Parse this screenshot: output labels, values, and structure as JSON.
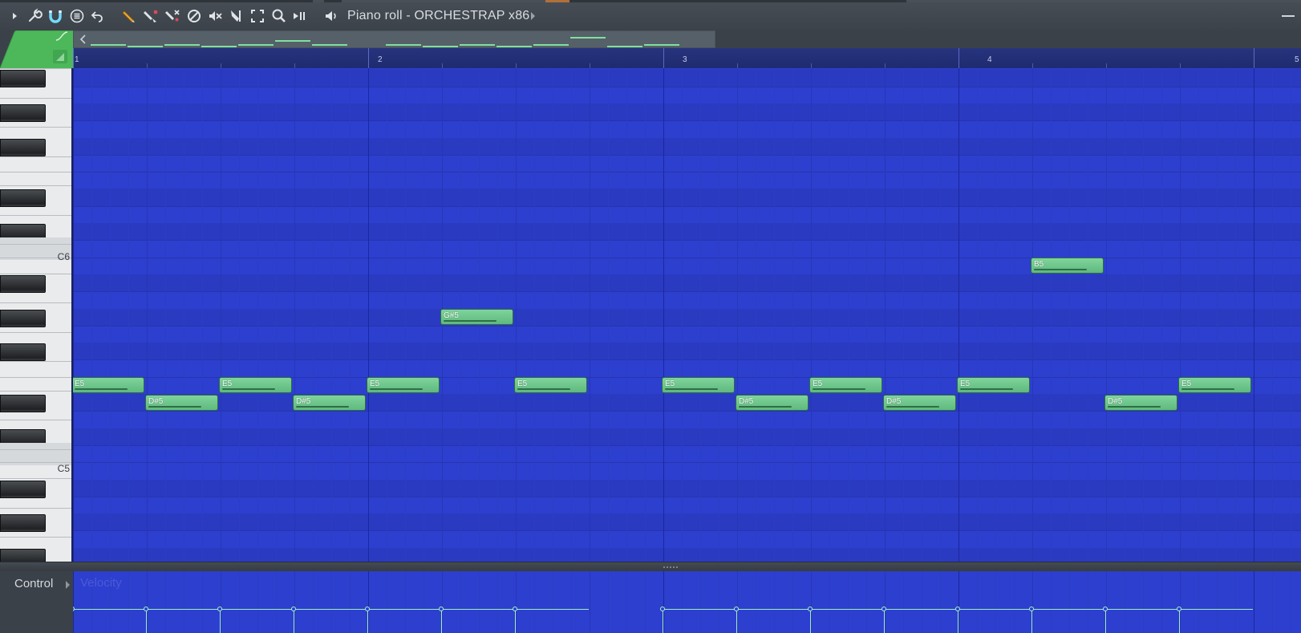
{
  "window": {
    "title": "Piano roll - ORCHESTRAP x86"
  },
  "toolbar": {
    "tools": [
      {
        "name": "play-arrow-icon",
        "interactable": true
      },
      {
        "name": "wrench-icon",
        "interactable": true
      },
      {
        "name": "magnet-icon",
        "interactable": true
      },
      {
        "name": "menu-icon",
        "interactable": true
      },
      {
        "name": "undo-icon",
        "interactable": true
      },
      {
        "name": "pencil-icon",
        "interactable": true
      },
      {
        "name": "paint-icon",
        "interactable": true
      },
      {
        "name": "delete-icon",
        "interactable": true
      },
      {
        "name": "mute-icon",
        "interactable": true
      },
      {
        "name": "speaker-mute-icon",
        "interactable": true
      },
      {
        "name": "slice-icon",
        "interactable": true
      },
      {
        "name": "select-icon",
        "interactable": true
      },
      {
        "name": "zoom-icon",
        "interactable": true
      },
      {
        "name": "playback-icon",
        "interactable": true
      },
      {
        "name": "speaker-icon",
        "interactable": true
      }
    ]
  },
  "ruler": {
    "bars": [
      "1",
      "2",
      "3",
      "4",
      "5"
    ]
  },
  "keyboard": {
    "labels": [
      "C6",
      "C5"
    ]
  },
  "notes": [
    {
      "pitch": "E5",
      "start": 0,
      "length": 1
    },
    {
      "pitch": "D#5",
      "start": 1,
      "length": 1
    },
    {
      "pitch": "E5",
      "start": 2,
      "length": 1
    },
    {
      "pitch": "D#5",
      "start": 3,
      "length": 1
    },
    {
      "pitch": "E5",
      "start": 4,
      "length": 1
    },
    {
      "pitch": "G#5",
      "start": 5,
      "length": 1
    },
    {
      "pitch": "E5",
      "start": 6,
      "length": 1
    },
    {
      "pitch": "E5",
      "start": 8,
      "length": 1
    },
    {
      "pitch": "D#5",
      "start": 9,
      "length": 1
    },
    {
      "pitch": "E5",
      "start": 10,
      "length": 1
    },
    {
      "pitch": "D#5",
      "start": 11,
      "length": 1
    },
    {
      "pitch": "E5",
      "start": 12,
      "length": 1
    },
    {
      "pitch": "B5",
      "start": 13,
      "length": 1
    },
    {
      "pitch": "D#5",
      "start": 14,
      "length": 1
    },
    {
      "pitch": "E5",
      "start": 15,
      "length": 1
    }
  ],
  "control": {
    "label": "Control",
    "parameter": "Velocity"
  },
  "colors": {
    "grid_background": "#2d3fce",
    "note_fill": "#6fc88c",
    "velocity_line": "#9ff0c4",
    "toolbar_background": "#41474e"
  }
}
